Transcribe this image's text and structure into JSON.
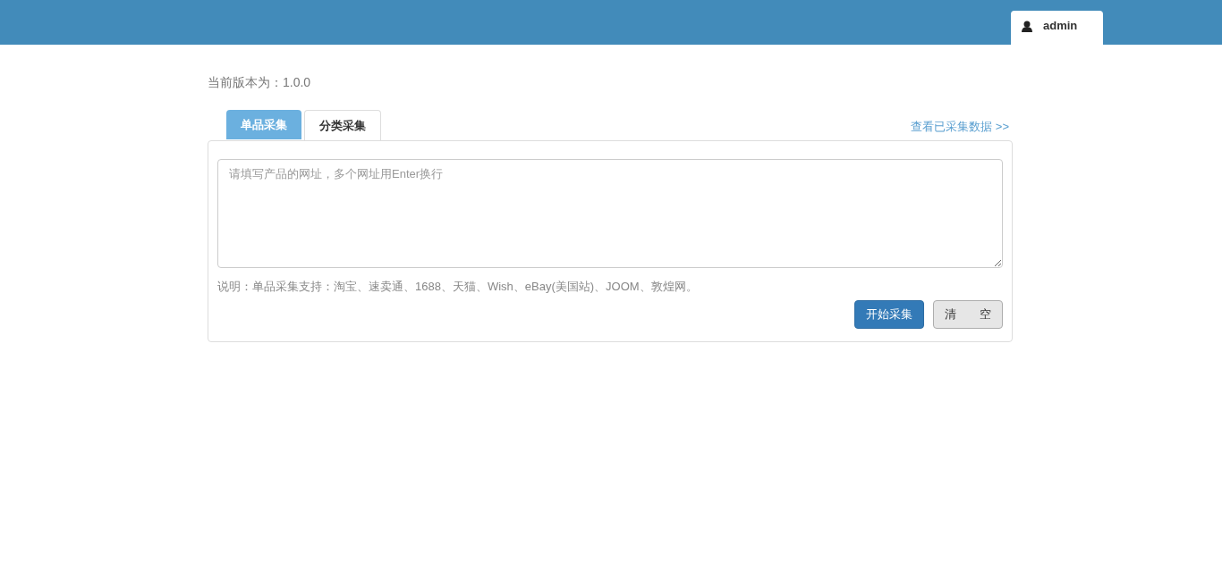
{
  "header": {
    "user": "admin"
  },
  "version_text": "当前版本为：1.0.0",
  "tabs": [
    {
      "label": "单品采集",
      "selected": true
    },
    {
      "label": "分类采集",
      "selected": false
    }
  ],
  "view_link": "查看已采集数据 >>",
  "url_field": {
    "placeholder": "请填写产品的网址，多个网址用Enter换行"
  },
  "note": "说明：单品采集支持：淘宝、速卖通、1688、天猫、Wish、eBay(美国站)、JOOM、敦煌网。",
  "buttons": [
    {
      "label": "开始采集",
      "kind": "primary"
    },
    {
      "label": "清　　空",
      "kind": "default"
    }
  ]
}
